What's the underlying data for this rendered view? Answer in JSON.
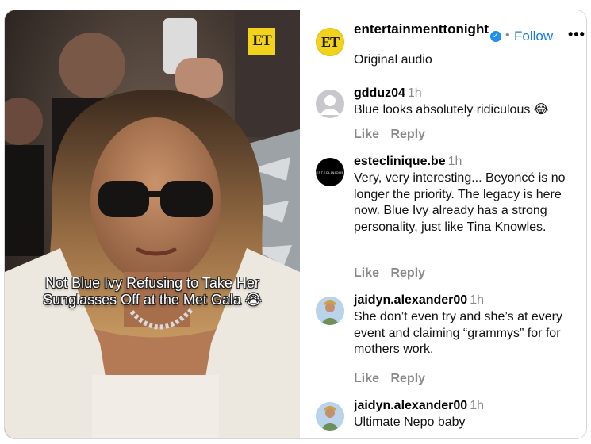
{
  "media": {
    "logo_text": "ET",
    "caption_lines": [
      "Not Blue Ivy Refusing to Take Her",
      "Sunglasses Off at the Met Gala 😭"
    ]
  },
  "header": {
    "author_name": "entertainmenttonight",
    "verified_icon": "✓",
    "follow_label": "Follow",
    "more_label": "•••",
    "audio_label": "Original audio"
  },
  "comments": [
    {
      "username": "gdduz04",
      "time": "1h",
      "text": "Blue looks absolutely ridiculous 😂",
      "like_label": "Like",
      "reply_label": "Reply"
    },
    {
      "username": "esteclinique.be",
      "avatar_text": "ESTECLINIQUE",
      "time": "1h",
      "text": "Very, very interesting... Beyoncé is no longer the priority. The legacy is here now. Blue Ivy already has a strong personality, just like Tina Knowles.",
      "like_label": "Like",
      "reply_label": "Reply"
    },
    {
      "username": "jaidyn.alexander00",
      "time": "1h",
      "text": "She don’t even try and she’s at every event and claiming “grammys” for for mothers work.",
      "like_label": "Like",
      "reply_label": "Reply"
    },
    {
      "username": "jaidyn.alexander00",
      "time": "1h",
      "text": "Ultimate Nepo baby"
    }
  ],
  "colors": {
    "link_blue": "#1877f2",
    "verified_blue": "#1f8ff0",
    "logo_yellow": "#f2d21b",
    "muted_gray": "#8a8a8a"
  }
}
